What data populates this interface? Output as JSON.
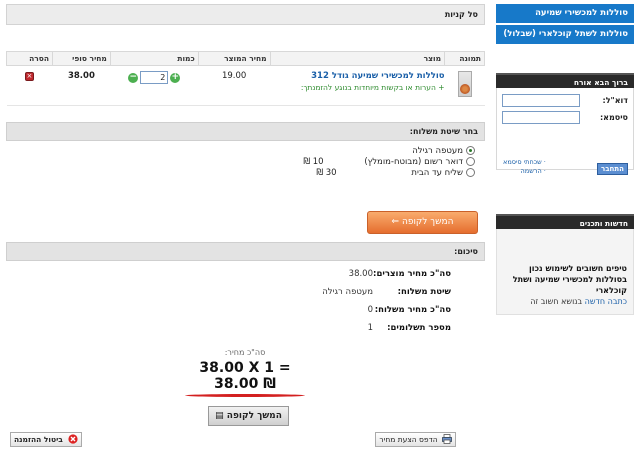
{
  "sidebar": {
    "nav": [
      "סוללות למכשירי שמיעה",
      "סוללות לשתל קוכלארי (שבלול)"
    ],
    "login": {
      "title": "ברוך הבא אורח",
      "email_label": "דוא\"ל:",
      "password_label": "סיסמא:",
      "forgot_link": "שכחתי סיסמא",
      "register_link": "הרשמה",
      "submit": "התחבר"
    },
    "news": {
      "title": "חדשות ותכנים",
      "headline": "טיפים חשובים לשימוש נכון בסוללות למכשירי שמיעה ושתל קוכלארי",
      "link_prefix": "כתבה חדשה",
      "link_suffix": "בנושא חשוב זה"
    }
  },
  "cart": {
    "title": "סל קניות",
    "columns": [
      "תמונה",
      "מוצר",
      "מחיר המוצר",
      "כמות",
      "מחיר סופי",
      "הסרה"
    ],
    "items": [
      {
        "name": "סוללות למכשירי שמיעה גודל 312",
        "note": "+ הערות או בקשות מיוחדות בנוגע להזמנתך:",
        "price": "19.00",
        "quantity": "2",
        "final_price": "38.00",
        "remove_glyph": "×"
      }
    ]
  },
  "shipping": {
    "title": "בחר שיטת משלוח:",
    "options": [
      {
        "label": "מעטפה רגילה",
        "price": "",
        "selected": true
      },
      {
        "label": "דואר רשום (מבוטח-מומלץ)",
        "price": "10 ₪",
        "selected": false
      },
      {
        "label": "שליח עד הבית",
        "price": "30 ₪",
        "selected": false
      }
    ]
  },
  "buttons": {
    "checkout_orange": "המשך לקופה",
    "checkout_gray": "המשך לקופה",
    "print": "הדפס הצעת מחיר",
    "cancel": "ביטול ההזמנה"
  },
  "summary": {
    "title": "סיכום:",
    "rows": [
      {
        "label": "סה\"כ מחיר מוצרים:",
        "value": "38.00"
      },
      {
        "label": "שיטת משלוח:",
        "value": "מעטפה רגילה"
      },
      {
        "label": "סה\"כ מחיר משלוח:",
        "value": "0"
      },
      {
        "label": "מספר תשלומים:",
        "value": "1"
      }
    ],
    "total_label": "סה\"כ מחיר:",
    "total_expression": "38.00 X 1 = 38.00 ₪"
  },
  "colors": {
    "nav_blue": "#1779c9",
    "checkout_orange": "#e25a12",
    "price_underline": "#d32020",
    "remove_red": "#c0282d",
    "qty_green": "#4caf50"
  }
}
